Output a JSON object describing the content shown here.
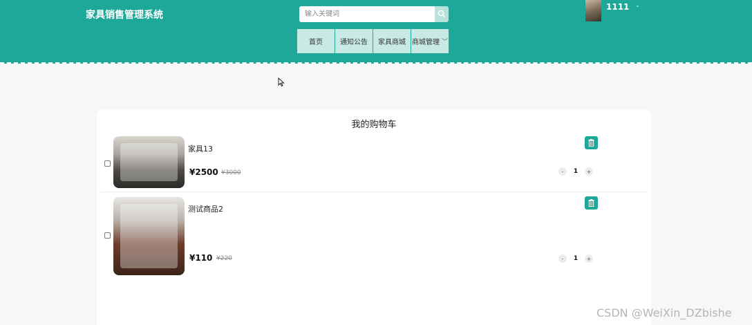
{
  "header": {
    "site_title": "家具销售管理系统",
    "search_placeholder": "输入关键词",
    "nav": [
      {
        "label": "首页"
      },
      {
        "label": "通知公告"
      },
      {
        "label": "家具商城"
      },
      {
        "label": "商城管理"
      }
    ],
    "user": {
      "name": "1111",
      "caret": "-"
    }
  },
  "cart": {
    "title": "我的购物车",
    "items": [
      {
        "name": "家具13",
        "price": "¥2500",
        "old_price": "¥3000",
        "qty": "1",
        "checked": false
      },
      {
        "name": "测试商品2",
        "price": "¥110",
        "old_price": "¥220",
        "qty": "1",
        "checked": false
      }
    ],
    "minus_label": "-",
    "plus_label": "+"
  },
  "watermark": "CSDN @WeiXin_DZbishe",
  "colors": {
    "accent": "#1ea89a",
    "nav_bg": "#c7ebe4",
    "page_bg": "#f7f7f7"
  }
}
